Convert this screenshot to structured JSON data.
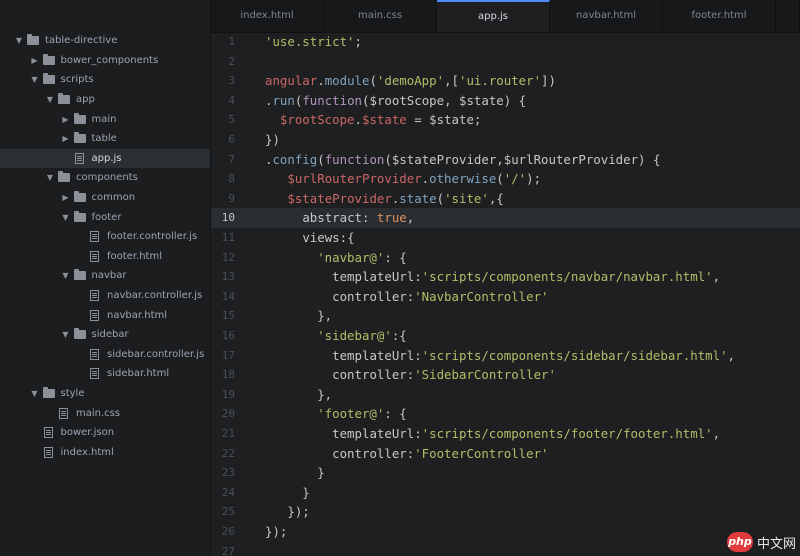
{
  "sidebar": {
    "items": [
      {
        "label": "table-directive",
        "type": "folder",
        "arrow": "down",
        "depth": 0
      },
      {
        "label": "bower_components",
        "type": "folder",
        "arrow": "right",
        "depth": 1
      },
      {
        "label": "scripts",
        "type": "folder",
        "arrow": "down",
        "depth": 1
      },
      {
        "label": "app",
        "type": "folder",
        "arrow": "down",
        "depth": 2
      },
      {
        "label": "main",
        "type": "folder",
        "arrow": "right",
        "depth": 3
      },
      {
        "label": "table",
        "type": "folder",
        "arrow": "right",
        "depth": 3
      },
      {
        "label": "app.js",
        "type": "file",
        "depth": 3,
        "selected": true
      },
      {
        "label": "components",
        "type": "folder",
        "arrow": "down",
        "depth": 2
      },
      {
        "label": "common",
        "type": "folder",
        "arrow": "right",
        "depth": 3
      },
      {
        "label": "footer",
        "type": "folder",
        "arrow": "down",
        "depth": 3
      },
      {
        "label": "footer.controller.js",
        "type": "file",
        "depth": 4
      },
      {
        "label": "footer.html",
        "type": "file",
        "depth": 4
      },
      {
        "label": "navbar",
        "type": "folder",
        "arrow": "down",
        "depth": 3
      },
      {
        "label": "navbar.controller.js",
        "type": "file",
        "depth": 4
      },
      {
        "label": "navbar.html",
        "type": "file",
        "depth": 4
      },
      {
        "label": "sidebar",
        "type": "folder",
        "arrow": "down",
        "depth": 3
      },
      {
        "label": "sidebar.controller.js",
        "type": "file",
        "depth": 4
      },
      {
        "label": "sidebar.html",
        "type": "file",
        "depth": 4
      },
      {
        "label": "style",
        "type": "folder",
        "arrow": "down",
        "depth": 1
      },
      {
        "label": "main.css",
        "type": "file",
        "depth": 2
      },
      {
        "label": "bower.json",
        "type": "file",
        "depth": 1
      },
      {
        "label": "index.html",
        "type": "file",
        "depth": 1
      }
    ]
  },
  "tabs": [
    {
      "label": "index.html",
      "active": false
    },
    {
      "label": "main.css",
      "active": false
    },
    {
      "label": "app.js",
      "active": true
    },
    {
      "label": "navbar.html",
      "active": false
    },
    {
      "label": "footer.html",
      "active": false
    },
    {
      "label": "",
      "active": false
    }
  ],
  "editor": {
    "current_line": 10,
    "lines": [
      {
        "n": "1",
        "tokens": [
          [
            "s",
            "'use.strict'"
          ],
          [
            "p",
            ";"
          ]
        ]
      },
      {
        "n": "2",
        "tokens": []
      },
      {
        "n": "3",
        "tokens": [
          [
            "v",
            "angular"
          ],
          [
            "p",
            "."
          ],
          [
            "f",
            "module"
          ],
          [
            "p",
            "("
          ],
          [
            "s",
            "'demoApp'"
          ],
          [
            "p",
            ",["
          ],
          [
            "s",
            "'ui.router'"
          ],
          [
            "p",
            "])"
          ]
        ]
      },
      {
        "n": "4",
        "tokens": [
          [
            "p",
            "."
          ],
          [
            "f",
            "run"
          ],
          [
            "p",
            "("
          ],
          [
            "k",
            "function"
          ],
          [
            "p",
            "("
          ],
          [
            "i",
            "$rootScope, $state"
          ],
          [
            "p",
            ") {"
          ]
        ]
      },
      {
        "n": "5",
        "tokens": [
          [
            "p",
            "  "
          ],
          [
            "v",
            "$rootScope"
          ],
          [
            "p",
            "."
          ],
          [
            "v",
            "$state"
          ],
          [
            "p",
            " = "
          ],
          [
            "i",
            "$state"
          ],
          [
            "p",
            ";"
          ]
        ]
      },
      {
        "n": "6",
        "tokens": [
          [
            "p",
            "})"
          ]
        ]
      },
      {
        "n": "7",
        "tokens": [
          [
            "p",
            "."
          ],
          [
            "f",
            "config"
          ],
          [
            "p",
            "("
          ],
          [
            "k",
            "function"
          ],
          [
            "p",
            "("
          ],
          [
            "i",
            "$stateProvider,$urlRouterProvider"
          ],
          [
            "p",
            ") {"
          ]
        ]
      },
      {
        "n": "8",
        "tokens": [
          [
            "p",
            "   "
          ],
          [
            "v",
            "$urlRouterProvider"
          ],
          [
            "p",
            "."
          ],
          [
            "f",
            "otherwise"
          ],
          [
            "p",
            "("
          ],
          [
            "s",
            "'/'"
          ],
          [
            "p",
            ");"
          ]
        ]
      },
      {
        "n": "9",
        "tokens": [
          [
            "p",
            "   "
          ],
          [
            "v",
            "$stateProvider"
          ],
          [
            "p",
            "."
          ],
          [
            "f",
            "state"
          ],
          [
            "p",
            "("
          ],
          [
            "s",
            "'site'"
          ],
          [
            "p",
            ",{"
          ]
        ]
      },
      {
        "n": "10",
        "tokens": [
          [
            "p",
            "     "
          ],
          [
            "i",
            "abstract"
          ],
          [
            "p",
            ": "
          ],
          [
            "c",
            "true"
          ],
          [
            "p",
            ","
          ]
        ]
      },
      {
        "n": "11",
        "tokens": [
          [
            "p",
            "     "
          ],
          [
            "i",
            "views"
          ],
          [
            "p",
            ":{"
          ]
        ]
      },
      {
        "n": "12",
        "tokens": [
          [
            "p",
            "       "
          ],
          [
            "s",
            "'navbar@'"
          ],
          [
            "p",
            ": {"
          ]
        ]
      },
      {
        "n": "13",
        "tokens": [
          [
            "p",
            "         "
          ],
          [
            "i",
            "templateUrl"
          ],
          [
            "p",
            ":"
          ],
          [
            "s",
            "'scripts/components/navbar/navbar.html'"
          ],
          [
            "p",
            ","
          ]
        ]
      },
      {
        "n": "14",
        "tokens": [
          [
            "p",
            "         "
          ],
          [
            "i",
            "controller"
          ],
          [
            "p",
            ":"
          ],
          [
            "s",
            "'NavbarController'"
          ]
        ]
      },
      {
        "n": "15",
        "tokens": [
          [
            "p",
            "       },"
          ]
        ]
      },
      {
        "n": "16",
        "tokens": [
          [
            "p",
            "       "
          ],
          [
            "s",
            "'sidebar@'"
          ],
          [
            "p",
            ":{"
          ]
        ]
      },
      {
        "n": "17",
        "tokens": [
          [
            "p",
            "         "
          ],
          [
            "i",
            "templateUrl"
          ],
          [
            "p",
            ":"
          ],
          [
            "s",
            "'scripts/components/sidebar/sidebar.html'"
          ],
          [
            "p",
            ","
          ]
        ]
      },
      {
        "n": "18",
        "tokens": [
          [
            "p",
            "         "
          ],
          [
            "i",
            "controller"
          ],
          [
            "p",
            ":"
          ],
          [
            "s",
            "'SidebarController'"
          ]
        ]
      },
      {
        "n": "19",
        "tokens": [
          [
            "p",
            "       },"
          ]
        ]
      },
      {
        "n": "20",
        "tokens": [
          [
            "p",
            "       "
          ],
          [
            "s",
            "'footer@'"
          ],
          [
            "p",
            ": {"
          ]
        ]
      },
      {
        "n": "21",
        "tokens": [
          [
            "p",
            "         "
          ],
          [
            "i",
            "templateUrl"
          ],
          [
            "p",
            ":"
          ],
          [
            "s",
            "'scripts/components/footer/footer.html'"
          ],
          [
            "p",
            ","
          ]
        ]
      },
      {
        "n": "22",
        "tokens": [
          [
            "p",
            "         "
          ],
          [
            "i",
            "controller"
          ],
          [
            "p",
            ":"
          ],
          [
            "s",
            "'FooterController'"
          ]
        ]
      },
      {
        "n": "23",
        "tokens": [
          [
            "p",
            "       }"
          ]
        ]
      },
      {
        "n": "24",
        "tokens": [
          [
            "p",
            "     }"
          ]
        ]
      },
      {
        "n": "25",
        "tokens": [
          [
            "p",
            "   });"
          ]
        ]
      },
      {
        "n": "26",
        "tokens": [
          [
            "p",
            "});"
          ]
        ]
      },
      {
        "n": "27",
        "tokens": []
      }
    ]
  },
  "watermark": {
    "logo": "php",
    "text": "中文网"
  }
}
